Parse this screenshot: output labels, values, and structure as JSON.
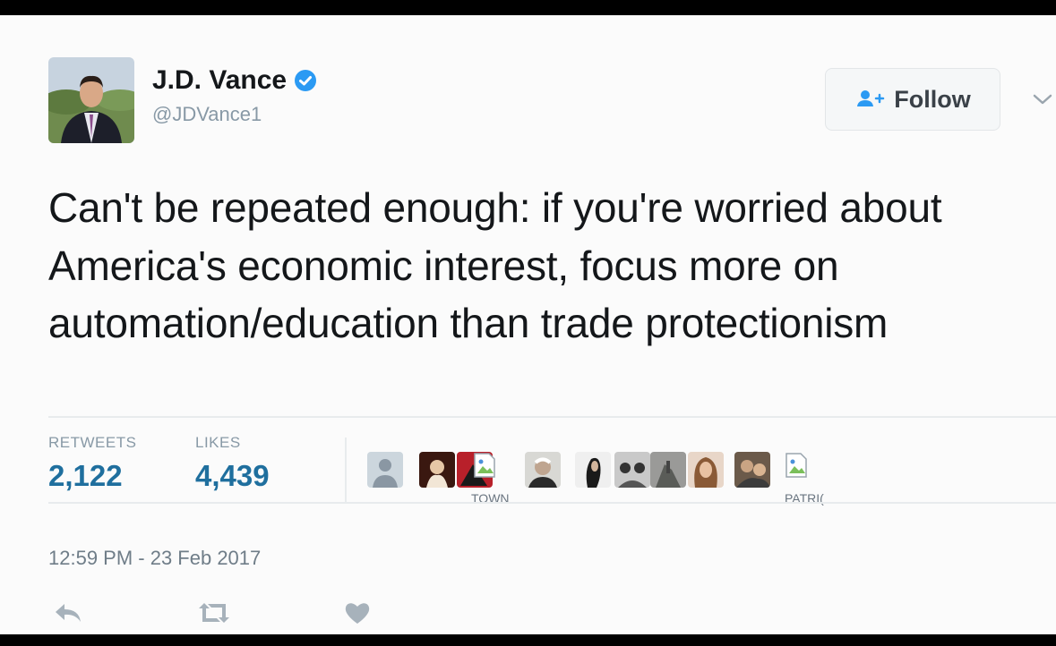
{
  "tweet": {
    "author_name": "J.D. Vance",
    "author_handle": "@JDVance1",
    "text": "Can't be repeated enough: if you're worried about America's economic interest, focus more on automation/education than trade protectionism",
    "follow_label": "Follow",
    "stats": {
      "retweets_label": "RETWEETS",
      "retweets_value": "2,122",
      "likes_label": "LIKES",
      "likes_value": "4,439"
    },
    "liker_labels": [
      "TOWN",
      "PATRI("
    ],
    "timestamp": "12:59 PM - 23 Feb 2017"
  },
  "icons": [
    "verified-badge-icon",
    "follow-user-icon",
    "chevron-down-icon",
    "reply-icon",
    "retweet-icon",
    "like-heart-icon",
    "broken-image-icon"
  ],
  "colors": {
    "link_blue": "#1f6f9e",
    "verified_blue": "#2b9af3",
    "text": "#14171a",
    "muted": "#8899a6"
  }
}
